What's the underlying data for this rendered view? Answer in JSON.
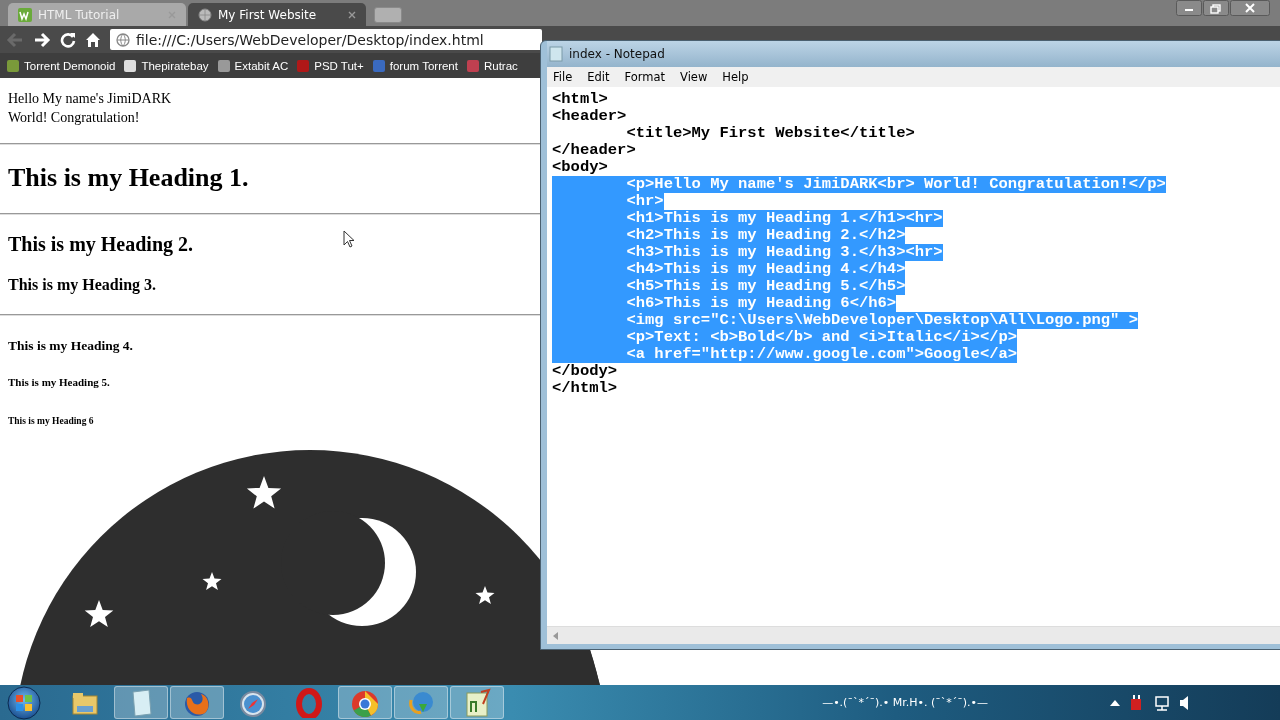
{
  "browser": {
    "tabs": [
      {
        "label": "HTML Tutorial",
        "selected": false
      },
      {
        "label": "My First Website",
        "selected": true
      }
    ],
    "address": "file:///C:/Users/WebDeveloper/Desktop/index.html",
    "bookmarks": [
      {
        "label": "Torrent Demonoid",
        "color": "#7a9a3a"
      },
      {
        "label": "Thepiratebay",
        "color": "#dddddd"
      },
      {
        "label": "Extabit AC",
        "color": "#999999"
      },
      {
        "label": "PSD Tut+",
        "color": "#b01818"
      },
      {
        "label": "forum Torrent",
        "color": "#3a6ac0"
      },
      {
        "label": "Rutrac",
        "color": "#c04050"
      }
    ]
  },
  "page": {
    "blocks": [
      {
        "kind": "p",
        "lines": [
          "Hello My name's JimiDARK",
          "World! Congratulation!"
        ]
      },
      {
        "kind": "hr"
      },
      {
        "kind": "h1",
        "text": "This is my Heading 1."
      },
      {
        "kind": "hr"
      },
      {
        "kind": "h2",
        "text": "This is my Heading 2."
      },
      {
        "kind": "h3",
        "text": "This is my Heading 3."
      },
      {
        "kind": "hr"
      },
      {
        "kind": "h4",
        "text": "This is my Heading 4."
      },
      {
        "kind": "h5",
        "text": "This is my Heading 5."
      },
      {
        "kind": "h6",
        "text": "This is my Heading 6"
      },
      {
        "kind": "picture"
      }
    ]
  },
  "notepad": {
    "title": "index - Notepad",
    "menu": [
      "File",
      "Edit",
      "Format",
      "View",
      "Help"
    ],
    "lines": [
      {
        "text": "<html>",
        "selected": false
      },
      {
        "text": "<header>",
        "selected": false
      },
      {
        "text": "\t<title>My First Website</title>",
        "selected": false
      },
      {
        "text": "</header>",
        "selected": false
      },
      {
        "text": "<body>",
        "selected": false
      },
      {
        "text": "\t<p>Hello My name's JimiDARK<br> World! Congratulation!</p>",
        "selected": true
      },
      {
        "text": "\t<hr>",
        "selected": true
      },
      {
        "text": "\t<h1>This is my Heading 1.</h1><hr>",
        "selected": true
      },
      {
        "text": "\t<h2>This is my Heading 2.</h2>",
        "selected": true
      },
      {
        "text": "\t<h3>This is my Heading 3.</h3><hr>",
        "selected": true
      },
      {
        "text": "\t<h4>This is my Heading 4.</h4>",
        "selected": true
      },
      {
        "text": "\t<h5>This is my Heading 5.</h5>",
        "selected": true
      },
      {
        "text": "\t<h6>This is my Heading 6</h6>",
        "selected": true
      },
      {
        "text": "\t<img src=\"C:\\Users\\WebDeveloper\\Desktop\\All\\Logo.png\" >",
        "selected": true
      },
      {
        "text": "\t<p>Text: <b>Bold</b> and <i>Italic</i></p>",
        "selected": true
      },
      {
        "text": "\t<a href=\"http://www.google.com\">Google</a>",
        "selected": true
      },
      {
        "text": "</body>",
        "selected": false
      },
      {
        "text": "</html>",
        "selected": false
      }
    ]
  },
  "taskbar": {
    "apps": [
      {
        "kind": "folder",
        "open": false
      },
      {
        "kind": "notepad",
        "open": true
      },
      {
        "kind": "firefox",
        "open": true
      },
      {
        "kind": "safari",
        "open": false
      },
      {
        "kind": "opera",
        "open": false
      },
      {
        "kind": "chrome",
        "open": true
      },
      {
        "kind": "download",
        "open": true
      },
      {
        "kind": "notepadpp",
        "open": true
      }
    ],
    "toolbar_text": "—•.(¯`*´¯).• Mr.H•. (¯`*´¯).•—"
  }
}
